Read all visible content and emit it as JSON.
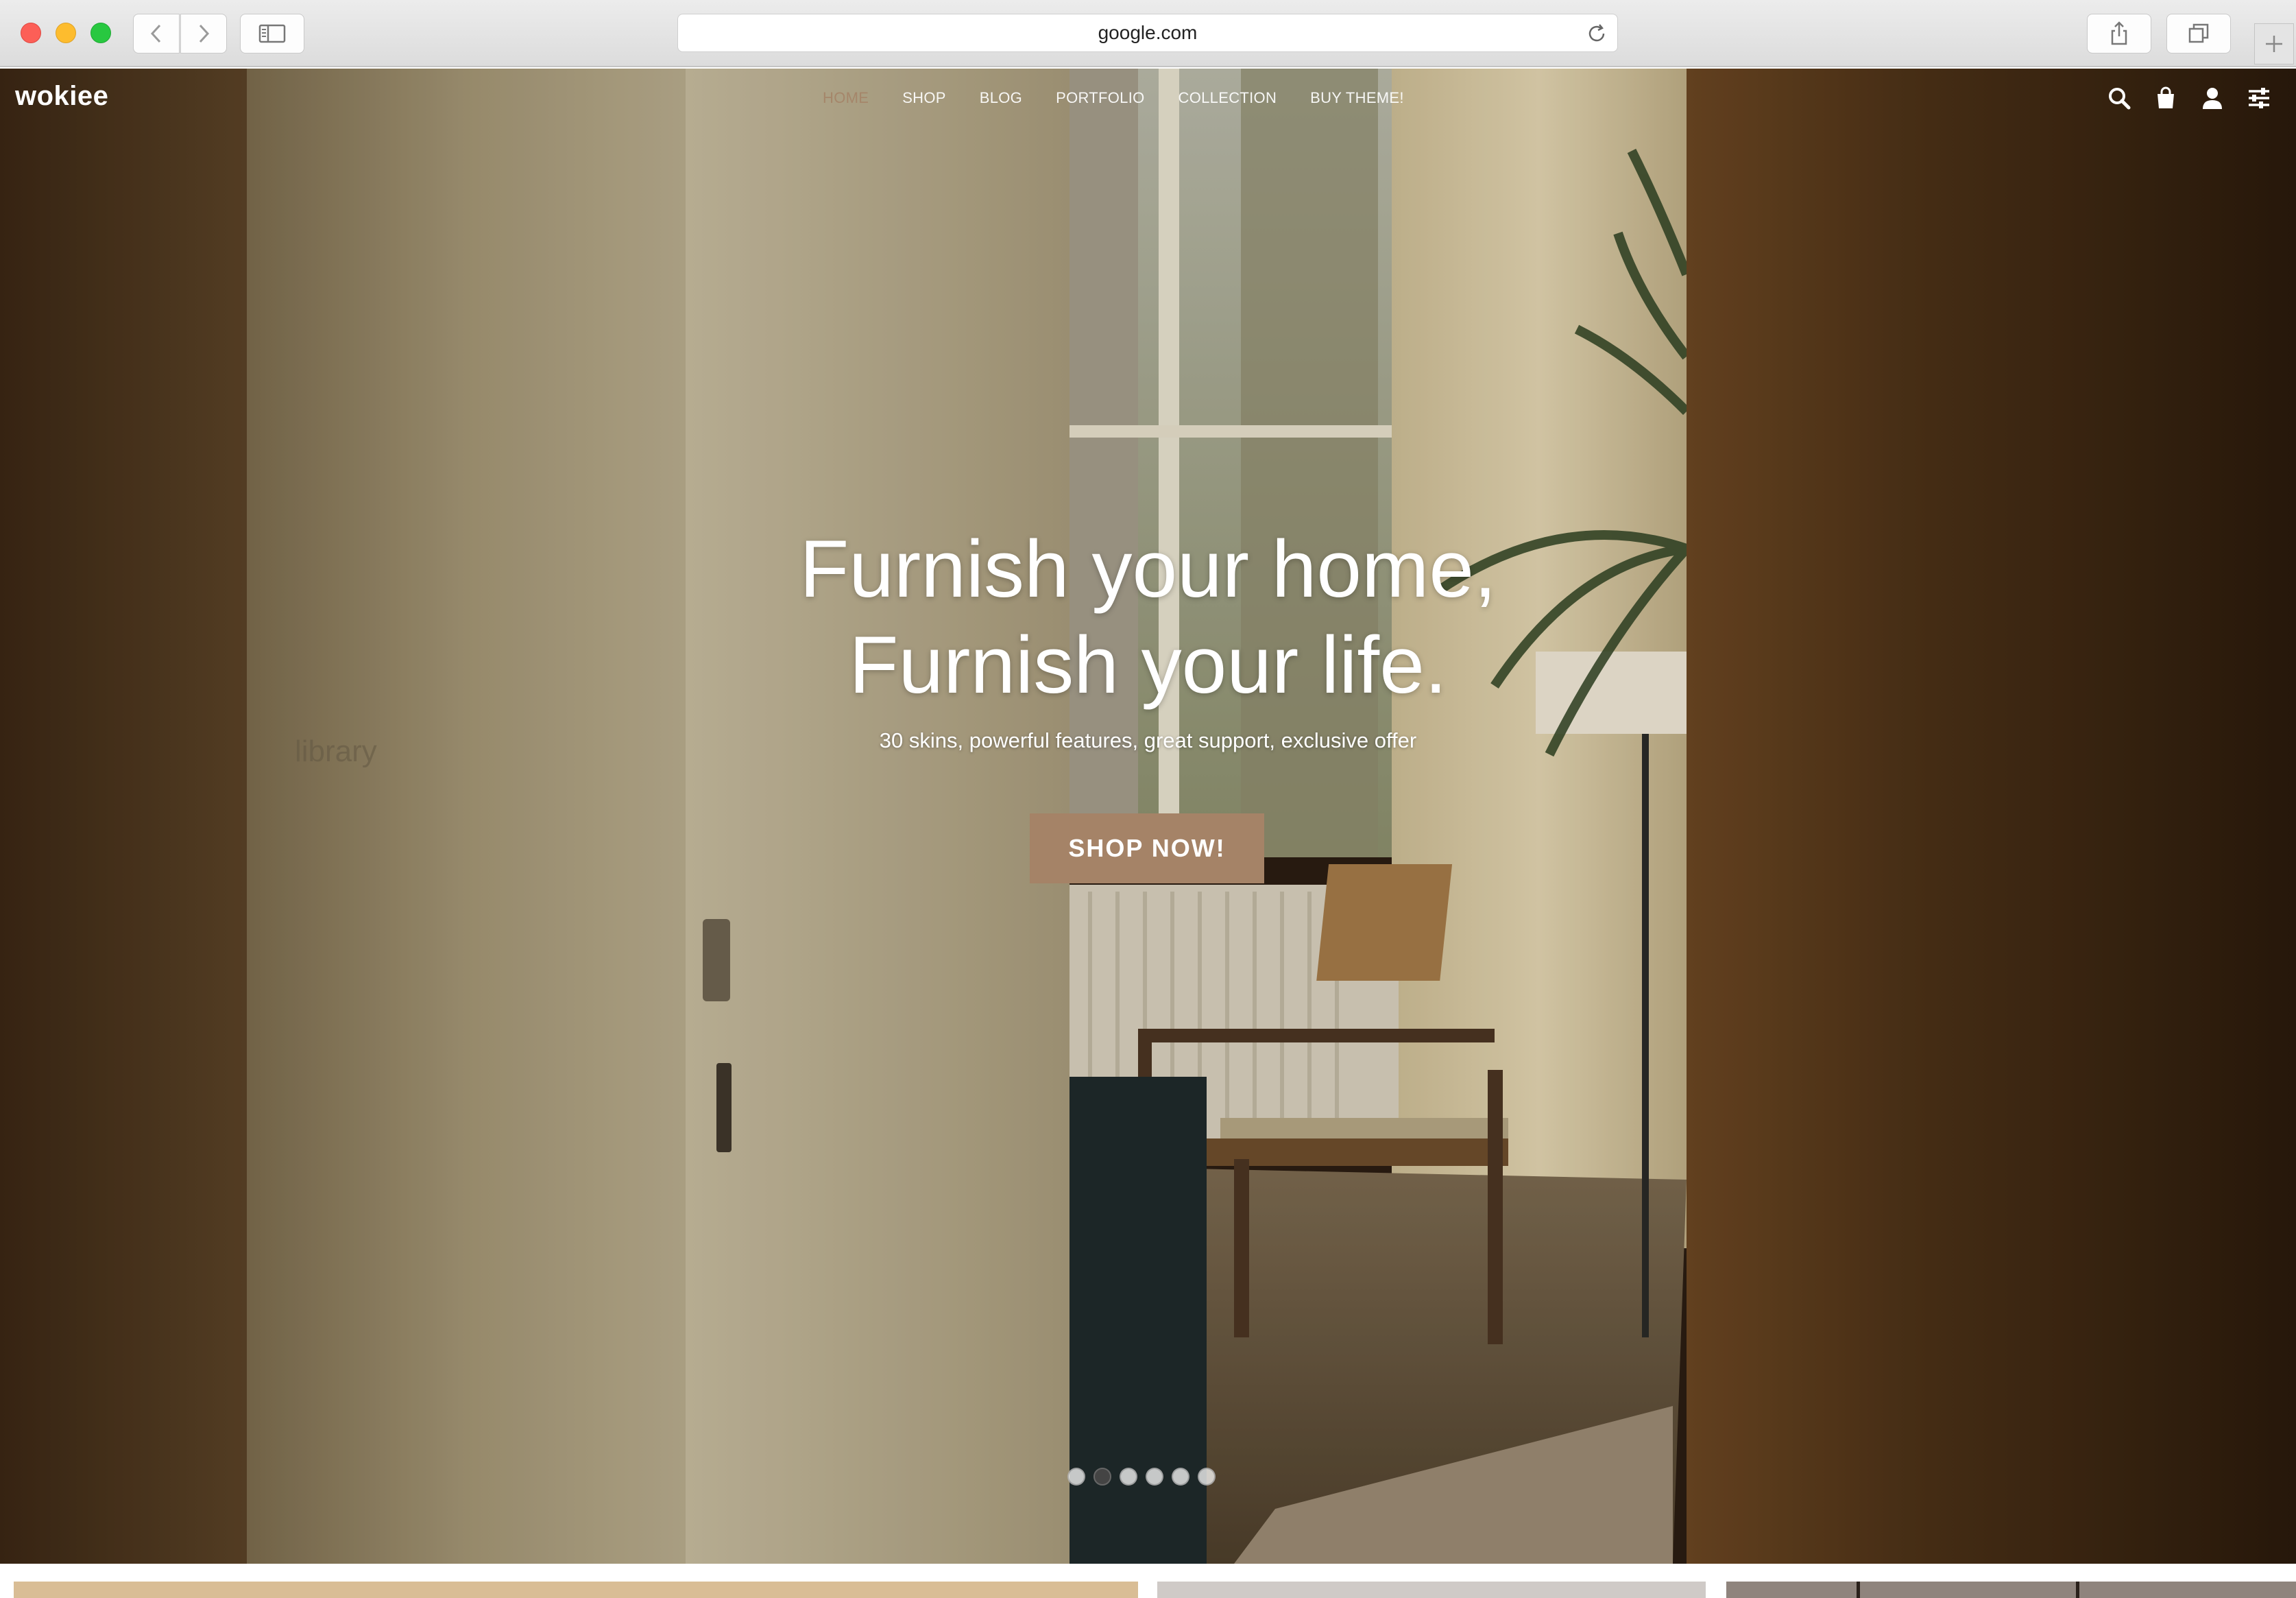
{
  "browser": {
    "url": "google.com"
  },
  "site": {
    "logo": "wokiee",
    "nav": [
      {
        "label": "HOME",
        "active": true
      },
      {
        "label": "SHOP",
        "active": false
      },
      {
        "label": "BLOG",
        "active": false
      },
      {
        "label": "PORTFOLIO",
        "active": false
      },
      {
        "label": "COLLECTION",
        "active": false
      },
      {
        "label": "BUY THEME!",
        "active": false
      }
    ],
    "header_icons": [
      "search-icon",
      "shopping-bag-icon",
      "user-icon",
      "settings-sliders-icon"
    ]
  },
  "hero": {
    "title_line1": "Furnish your home,",
    "title_line2": "Furnish your life.",
    "subtitle": "30 skins, powerful features, great support, exclusive offer",
    "cta": "SHOP NOW!",
    "accent_color": "#a58367",
    "slides": 6,
    "active_slide": 2
  }
}
